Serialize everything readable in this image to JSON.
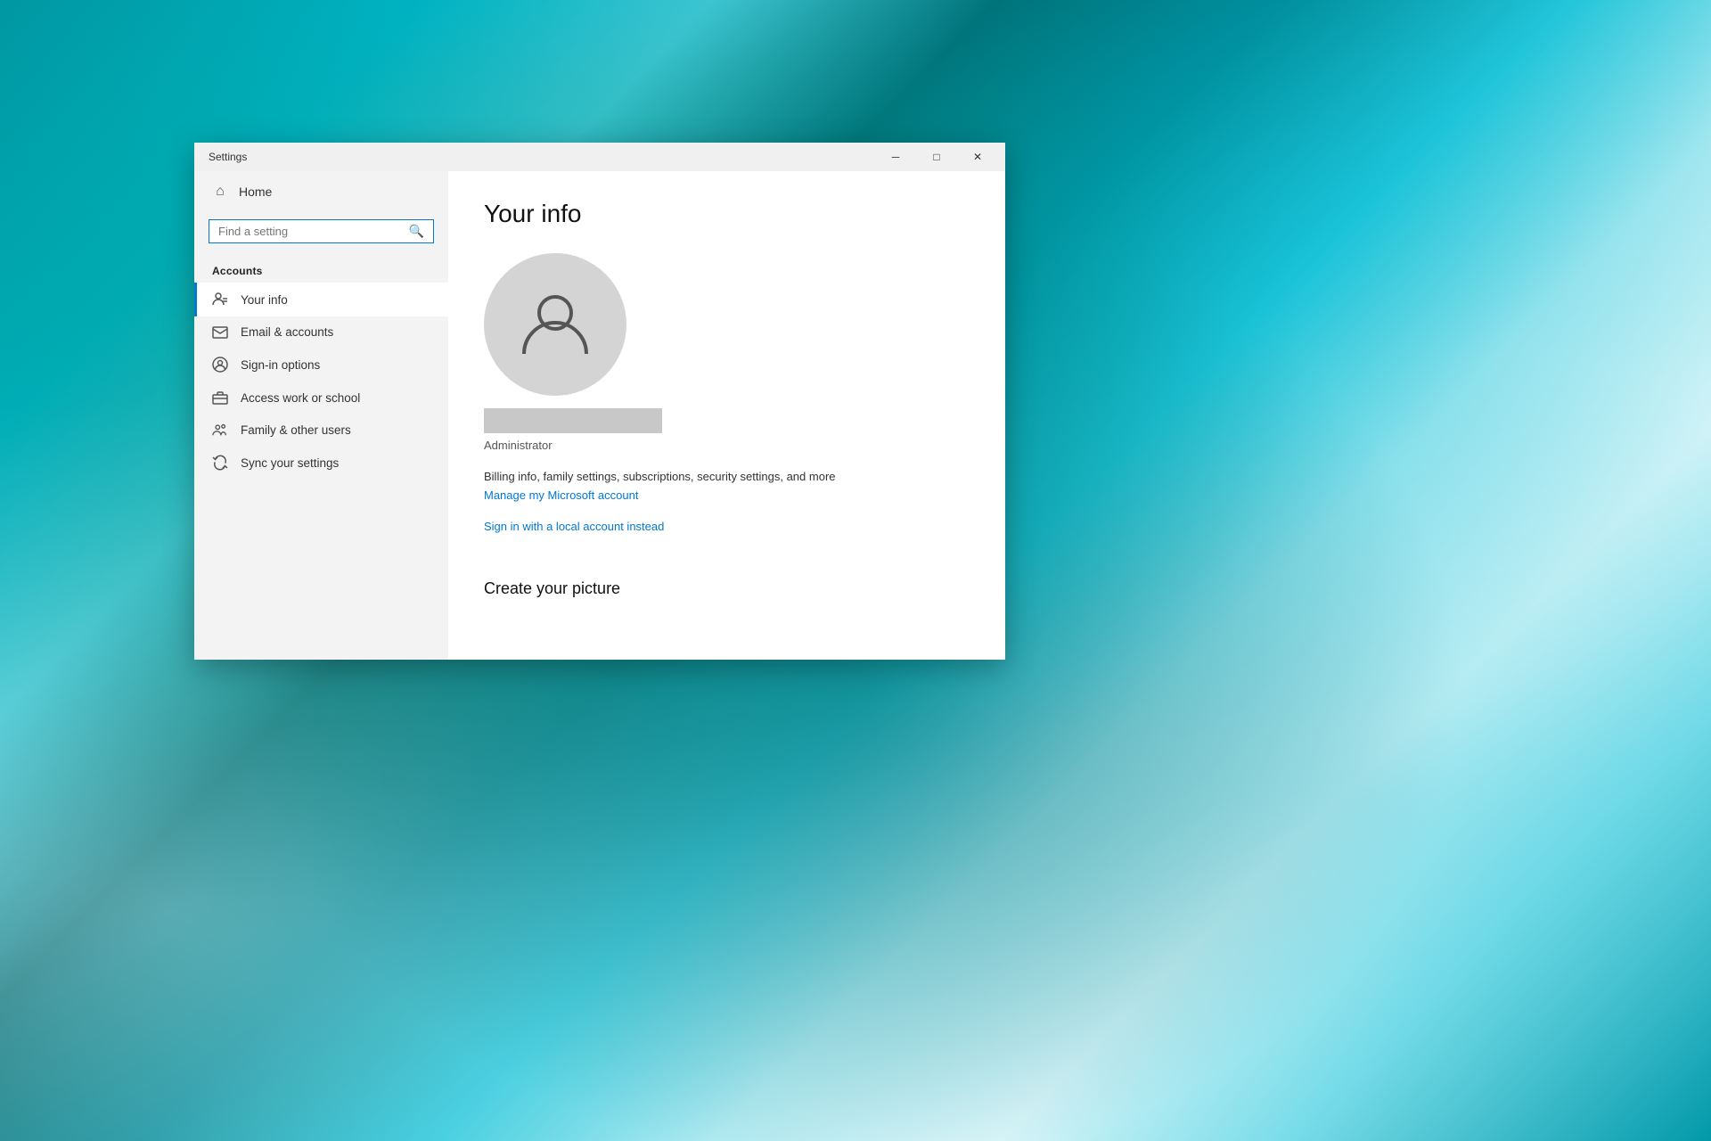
{
  "desktop": {
    "bg_description": "Teal ocean water aerial view"
  },
  "window": {
    "title": "Settings",
    "controls": {
      "minimize": "─",
      "maximize": "□",
      "close": "✕"
    }
  },
  "sidebar": {
    "home_label": "Home",
    "search_placeholder": "Find a setting",
    "section_title": "Accounts",
    "items": [
      {
        "id": "your-info",
        "label": "Your info",
        "active": true
      },
      {
        "id": "email-accounts",
        "label": "Email & accounts",
        "active": false
      },
      {
        "id": "sign-in",
        "label": "Sign-in options",
        "active": false
      },
      {
        "id": "access-work",
        "label": "Access work or school",
        "active": false
      },
      {
        "id": "family",
        "label": "Family & other users",
        "active": false
      },
      {
        "id": "sync",
        "label": "Sync your settings",
        "active": false
      }
    ]
  },
  "main": {
    "page_title": "Your info",
    "user_role": "Administrator",
    "billing_text": "Billing info, family settings, subscriptions, security settings, and more",
    "manage_link": "Manage my Microsoft account",
    "local_account_link": "Sign in with a local account instead",
    "create_picture_title": "Create your picture"
  }
}
